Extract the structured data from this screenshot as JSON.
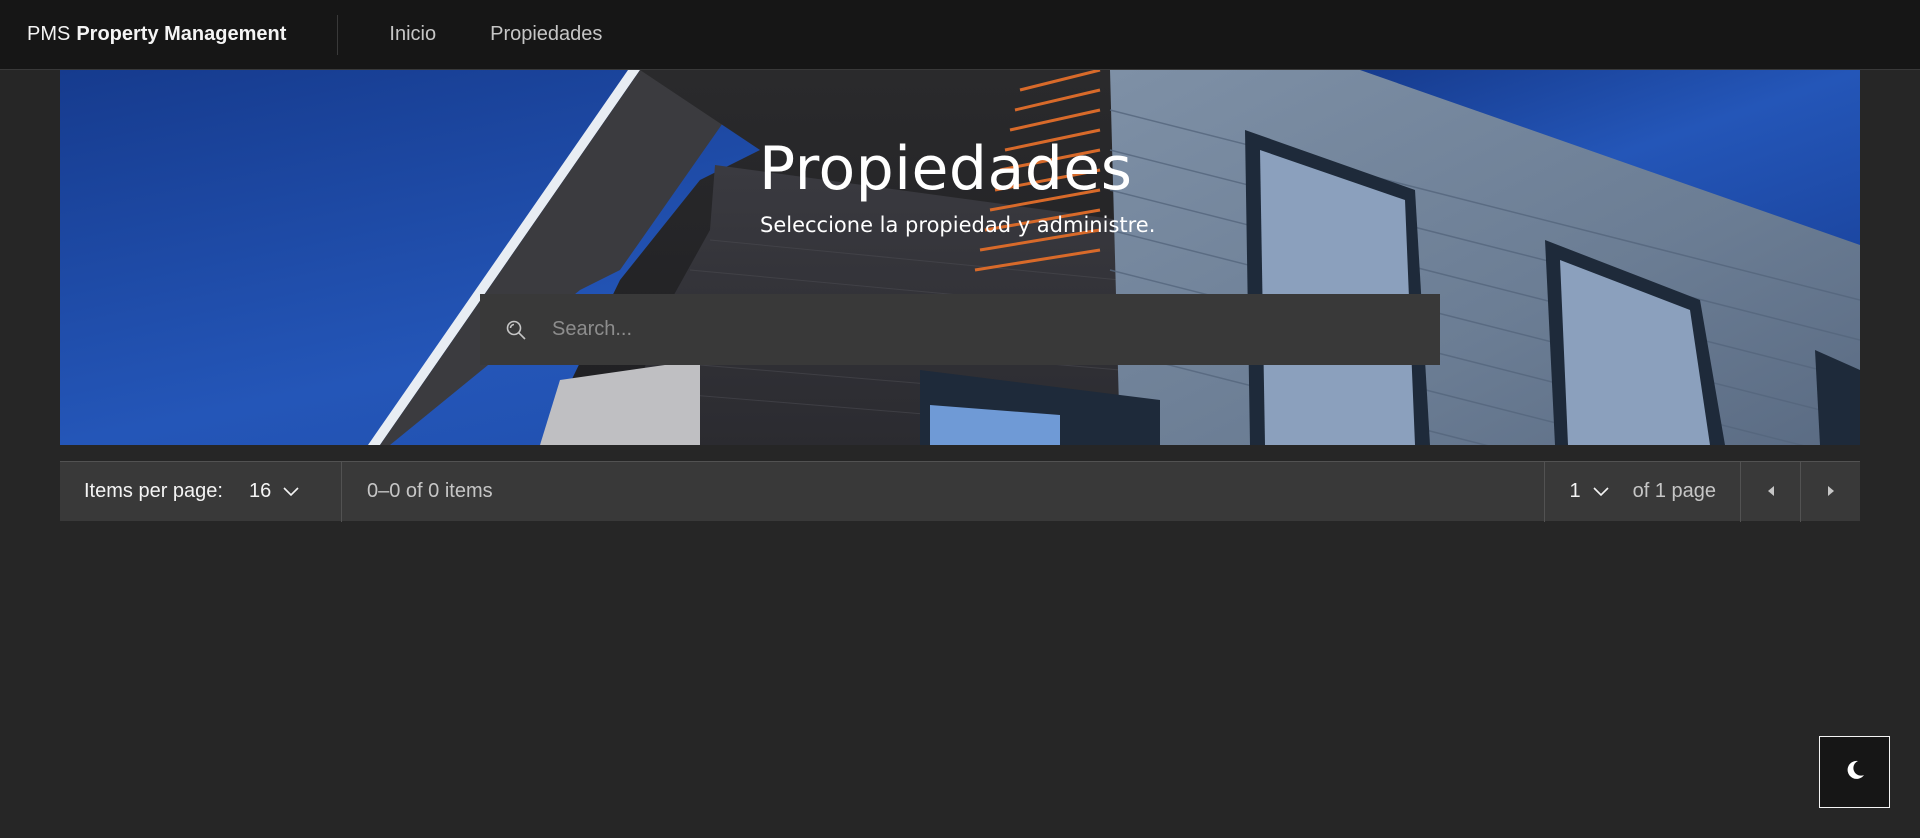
{
  "header": {
    "brand_prefix": "PMS",
    "brand_name": "Property Management",
    "nav": [
      {
        "label": "Inicio"
      },
      {
        "label": "Propiedades"
      }
    ]
  },
  "hero": {
    "title": "Propiedades",
    "subtitle": "Seleccione la propiedad y administre.",
    "search_placeholder": "Search..."
  },
  "pagination": {
    "items_per_page_label": "Items per page:",
    "items_per_page_value": "16",
    "items_range": "0–0 of 0 items",
    "page_value": "1",
    "page_total": "of 1 page"
  },
  "icons": {
    "search": "search-icon",
    "chevron": "chevron-down-icon",
    "prev": "caret-left-icon",
    "next": "caret-right-icon",
    "theme": "moon-icon"
  },
  "colors": {
    "background": "#262626",
    "header": "#161616",
    "surface": "#393939",
    "sky": "#2354b3"
  }
}
